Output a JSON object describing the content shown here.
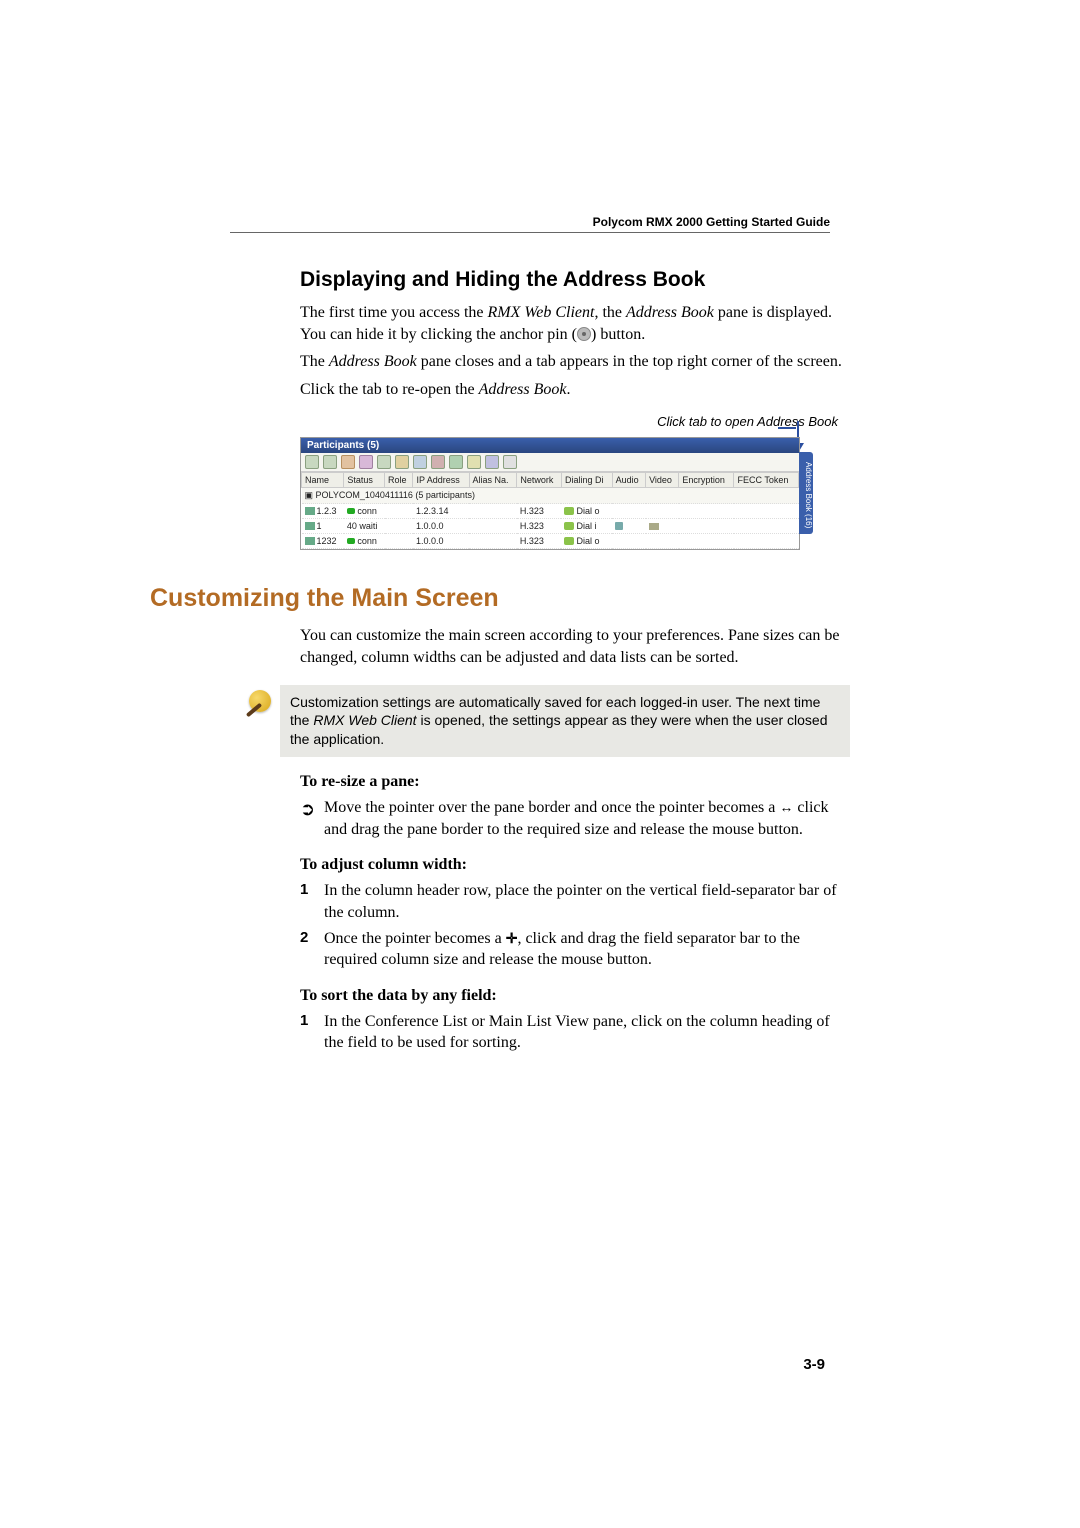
{
  "header": {
    "title": "Polycom RMX 2000 Getting Started Guide"
  },
  "section1": {
    "heading": "Displaying and Hiding the Address Book",
    "p1a": "The first time you access the ",
    "p1b": "RMX Web Client",
    "p1c": ", the ",
    "p1d": "Address Book",
    "p1e": " pane is displayed. You can hide it by clicking the anchor pin (",
    "p1f": ") button.",
    "p2a": "The ",
    "p2b": "Address Book",
    "p2c": " pane closes and a tab appears in the top right corner of the screen.",
    "p3a": "Click the tab to re-open the ",
    "p3b": "Address Book",
    "p3c": ".",
    "callout": "Click tab to open Address Book"
  },
  "screenshot": {
    "title": "Participants (5)",
    "columns": [
      "Name",
      "Status",
      "Role",
      "IP Address",
      "Alias Na.",
      "Network",
      "Dialing Di",
      "Audio",
      "Video",
      "Encryption",
      "FECC Token"
    ],
    "group": "POLYCOM_1040411116 (5 participants)",
    "rows": [
      {
        "name": "1.2.3",
        "status": "conn",
        "role": "",
        "ip": "1.2.3.14",
        "alias": "",
        "net": "H.323",
        "dial": "Dial o",
        "audio": "",
        "video": ""
      },
      {
        "name": "1",
        "status": "waiti",
        "role": "40",
        "ip": "1.0.0.0",
        "alias": "",
        "net": "H.323",
        "dial": "Dial i",
        "audio": "a",
        "video": "v"
      },
      {
        "name": "1232",
        "status": "conn",
        "role": "",
        "ip": "1.0.0.0",
        "alias": "",
        "net": "H.323",
        "dial": "Dial o",
        "audio": "",
        "video": ""
      }
    ],
    "sidetab": "Address Book  (16)"
  },
  "section2": {
    "heading": "Customizing the Main Screen",
    "p1": "You can customize the main screen according to your preferences. Pane sizes can be changed, column widths can be adjusted and data  lists can be sorted.",
    "note_a": "Customization settings are automatically saved for each logged-in user. The next time the ",
    "note_b": "RMX Web Client",
    "note_c": " is opened, the settings appear as they were when the user closed the application.",
    "resize_label": "To re-size a pane:",
    "resize_b_a": "Move the pointer over the pane border and once the pointer becomes a ",
    "resize_b_b": " click and drag the pane border to the required size and release the mouse button.",
    "colwidth_label": "To adjust column width:",
    "col_s1": "In the column header row, place the pointer on the vertical field-separator bar of the column.",
    "col_s2_a": "Once the pointer becomes a ",
    "col_s2_b": ", click and drag the field separator bar to the required column size and release the mouse button.",
    "sort_label": "To sort the data by any field:",
    "sort_s1_a": "In the ",
    "sort_s1_b": "Conference List",
    "sort_s1_c": " or ",
    "sort_s1_d": "Main List View",
    "sort_s1_e": " pane, click on the column heading of the field to be used for sorting."
  },
  "page_number": "3-9"
}
